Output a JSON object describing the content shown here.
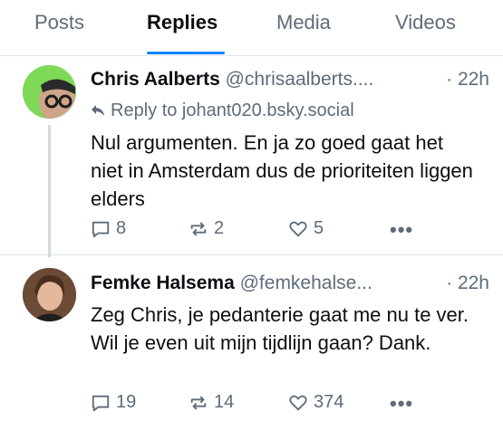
{
  "tabs": [
    {
      "label": "Posts"
    },
    {
      "label": "Replies"
    },
    {
      "label": "Media"
    },
    {
      "label": "Videos"
    }
  ],
  "posts": [
    {
      "name": "Chris Aalberts",
      "handle": "@chrisaalberts....",
      "time": "· 22h",
      "reply_to": "Reply to johant020.bsky.social",
      "text": "Nul argumenten. En ja zo goed gaat het niet in Amsterdam dus de prioriteiten liggen elders",
      "replies": "8",
      "reposts": "2",
      "likes": "5",
      "more": "•••"
    },
    {
      "name": "Femke Halsema",
      "handle": "@femkehalse...",
      "time": "· 22h",
      "text": "Zeg Chris, je pedanterie gaat me nu te ver. Wil je even uit mijn tijdlijn gaan? Dank.",
      "replies": "19",
      "reposts": "14",
      "likes": "374",
      "more": "•••"
    }
  ],
  "colors": {
    "accent": "#1083fe",
    "muted": "#5d6b7a",
    "divider": "#dfe3e8"
  }
}
